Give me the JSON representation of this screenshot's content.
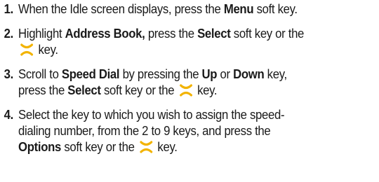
{
  "steps": [
    {
      "number": "1.",
      "t1": "When the Idle screen displays, press the ",
      "b1": "Menu",
      "t2": " soft key."
    },
    {
      "number": "2.",
      "t1": "Highlight ",
      "b1": "Address Book,",
      "t2": " press the ",
      "b2": "Select",
      "t3": " soft key or the",
      "t4": " key."
    },
    {
      "number": "3.",
      "t1": "Scroll to ",
      "b1": "Speed Dial",
      "t2": " by pressing the ",
      "b2": "Up",
      "t3": " or ",
      "b3": "Down",
      "t4": " key,",
      "t5": "press the ",
      "b4": "Select",
      "t6": " soft key or the ",
      "t7": " key."
    },
    {
      "number": "4.",
      "t1": "Select the key to which you wish to assign the speed-",
      "t2": "dialing number, from the 2 to 9 keys, and press the",
      "b1": "Options",
      "t3": " soft key or the ",
      "t4": " key."
    }
  ],
  "icons": {
    "ok_key": "ok-key-icon",
    "ok_key_color": "#f2b300"
  }
}
